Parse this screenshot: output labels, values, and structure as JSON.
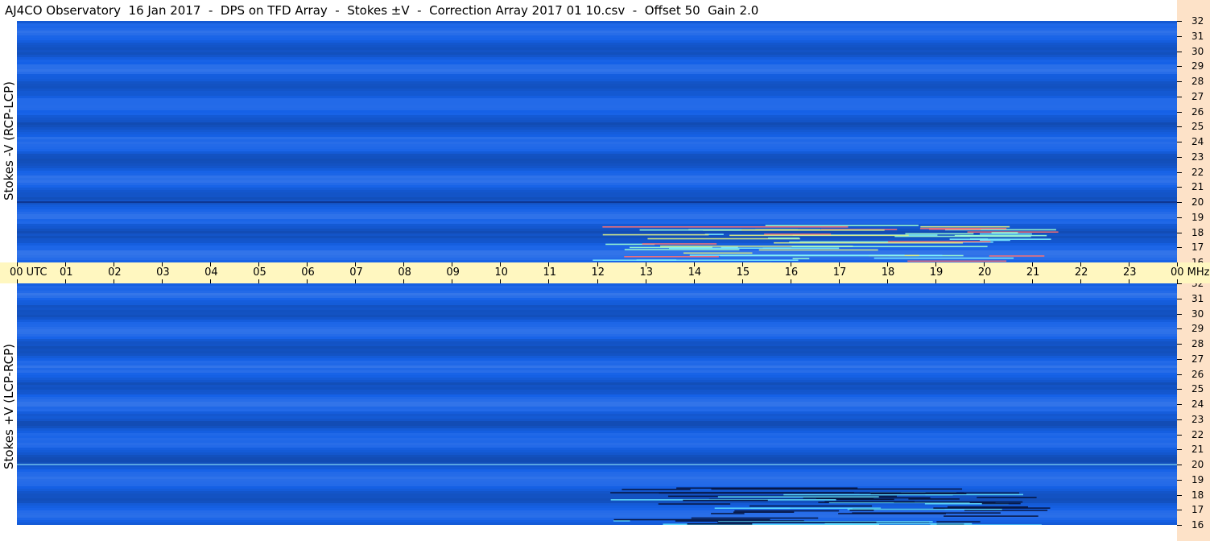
{
  "title": "AJ4CO Observatory  16 Jan 2017  -  DPS on TFD Array  -  Stokes ±V  -  Correction Array 2017 01 10.csv  -  Offset 50  Gain 2.0",
  "chart_data": {
    "type": "heatmap",
    "panels": [
      {
        "name": "top",
        "ylabel": "Stokes -V (RCP-LCP)",
        "yrange": [
          16,
          32
        ]
      },
      {
        "name": "bottom",
        "ylabel": "Stokes +V (LCP-RCP)",
        "yrange": [
          16,
          32
        ]
      }
    ],
    "x_ticks": [
      "00  UTC",
      "01",
      "02",
      "03",
      "04",
      "05",
      "06",
      "07",
      "08",
      "09",
      "10",
      "11",
      "12",
      "13",
      "14",
      "15",
      "16",
      "17",
      "18",
      "19",
      "20",
      "21",
      "22",
      "23",
      "00 MHz"
    ],
    "xrange_hours": [
      0,
      24
    ],
    "y_ticks": [
      "32",
      "31",
      "30",
      "29",
      "28",
      "27",
      "26",
      "25",
      "24",
      "23",
      "22",
      "21",
      "20",
      "19",
      "18",
      "17",
      "16"
    ],
    "colors": {
      "background_blue": "#1a5fe0",
      "axis_band": "#fff7c0",
      "right_strip": "#fde2c8"
    },
    "features": [
      {
        "panel": "top",
        "desc_kind": "burst",
        "t_start": 11.9,
        "t_end": 22.5,
        "f_low": 16,
        "f_high": 18.5
      },
      {
        "panel": "bottom",
        "desc_kind": "burst",
        "t_start": 11.9,
        "t_end": 22.5,
        "f_low": 16,
        "f_high": 18.5
      }
    ]
  }
}
